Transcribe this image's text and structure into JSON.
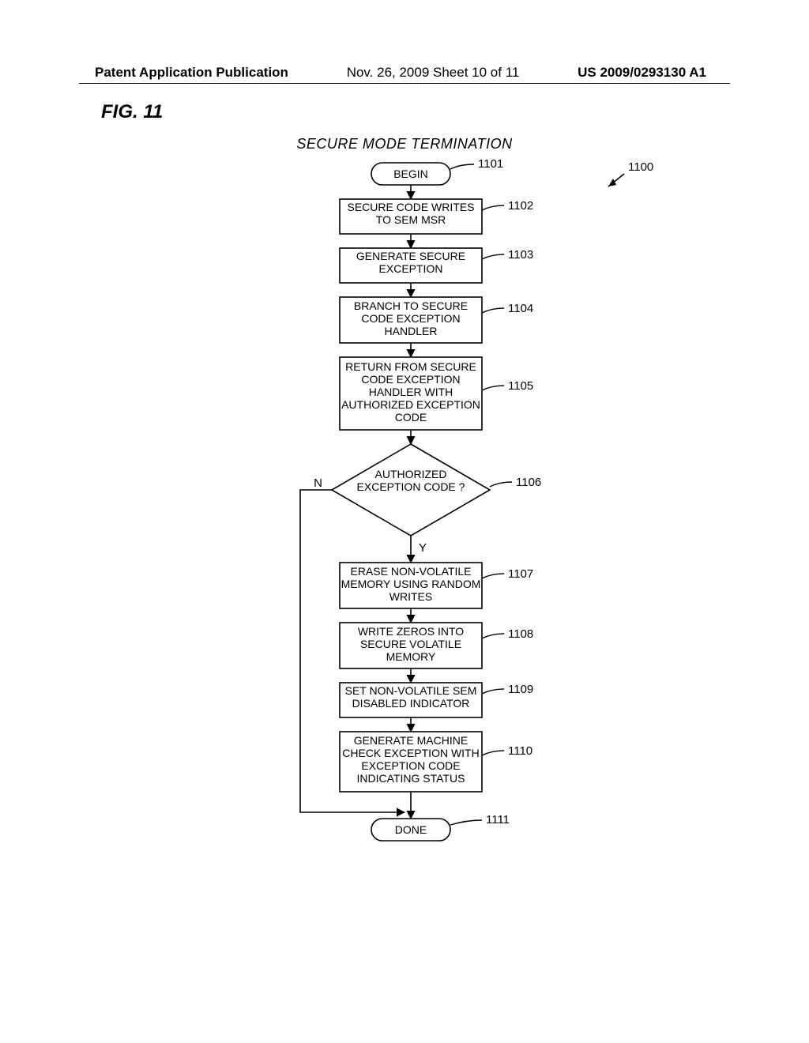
{
  "header": {
    "left": "Patent Application Publication",
    "mid": "Nov. 26, 2009  Sheet 10 of 11",
    "right": "US 2009/0293130 A1"
  },
  "figure_label": "FIG. 11",
  "chart_title": "SECURE MODE TERMINATION",
  "chart_data": {
    "type": "flowchart",
    "overall_ref": "1100",
    "nodes": [
      {
        "id": "1101",
        "ref": "1101",
        "shape": "terminator",
        "text": "BEGIN"
      },
      {
        "id": "1102",
        "ref": "1102",
        "shape": "process",
        "text": "SECURE CODE WRITES TO SEM MSR"
      },
      {
        "id": "1103",
        "ref": "1103",
        "shape": "process",
        "text": "GENERATE SECURE EXCEPTION"
      },
      {
        "id": "1104",
        "ref": "1104",
        "shape": "process",
        "text": "BRANCH TO SECURE CODE EXCEPTION HANDLER"
      },
      {
        "id": "1105",
        "ref": "1105",
        "shape": "process",
        "text": "RETURN FROM SECURE CODE EXCEPTION HANDLER WITH AUTHORIZED EXCEPTION CODE"
      },
      {
        "id": "1106",
        "ref": "1106",
        "shape": "decision",
        "text": "AUTHORIZED EXCEPTION CODE ?"
      },
      {
        "id": "1107",
        "ref": "1107",
        "shape": "process",
        "text": "ERASE NON-VOLATILE MEMORY USING RANDOM WRITES"
      },
      {
        "id": "1108",
        "ref": "1108",
        "shape": "process",
        "text": "WRITE ZEROS INTO SECURE VOLATILE MEMORY"
      },
      {
        "id": "1109",
        "ref": "1109",
        "shape": "process",
        "text": "SET NON-VOLATILE SEM DISABLED INDICATOR"
      },
      {
        "id": "1110",
        "ref": "1110",
        "shape": "process",
        "text": "GENERATE MACHINE CHECK EXCEPTION WITH EXCEPTION CODE INDICATING STATUS"
      },
      {
        "id": "1111",
        "ref": "1111",
        "shape": "terminator",
        "text": "DONE"
      }
    ],
    "edges": [
      {
        "from": "1101",
        "to": "1102"
      },
      {
        "from": "1102",
        "to": "1103"
      },
      {
        "from": "1103",
        "to": "1104"
      },
      {
        "from": "1104",
        "to": "1105"
      },
      {
        "from": "1105",
        "to": "1106"
      },
      {
        "from": "1106",
        "to": "1107",
        "label": "Y"
      },
      {
        "from": "1106",
        "to": "1111",
        "label": "N"
      },
      {
        "from": "1107",
        "to": "1108"
      },
      {
        "from": "1108",
        "to": "1109"
      },
      {
        "from": "1109",
        "to": "1110"
      },
      {
        "from": "1110",
        "to": "1111"
      }
    ],
    "decision_labels": {
      "yes": "Y",
      "no": "N"
    }
  }
}
